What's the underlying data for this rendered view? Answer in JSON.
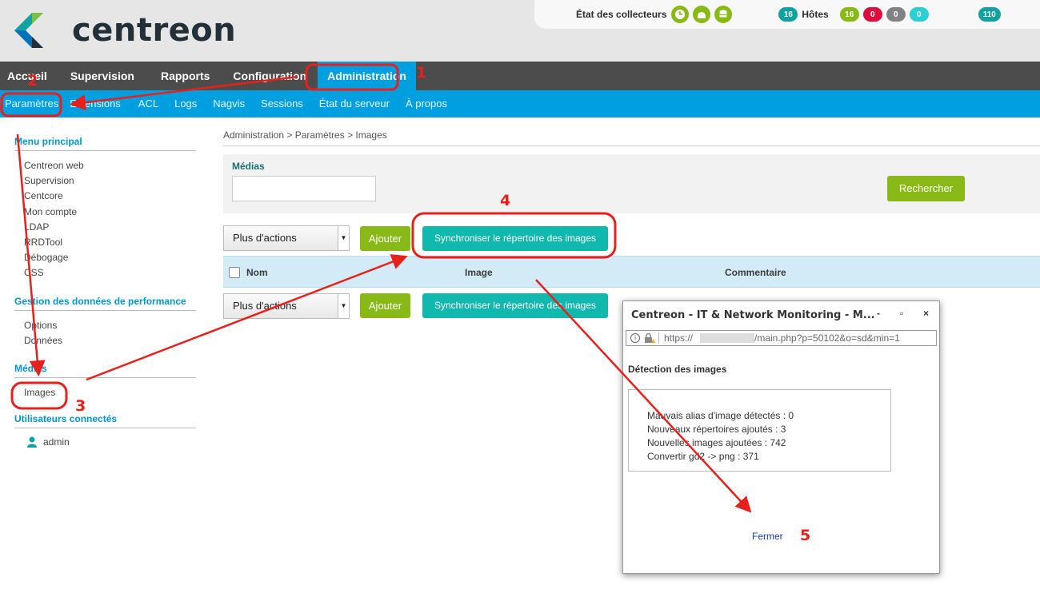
{
  "header": {
    "logo_text": "centreon",
    "collectors_label": "État des collecteurs",
    "hosts_count": "16",
    "hosts_label": "Hôtes",
    "host_status": [
      "16",
      "0",
      "0",
      "0"
    ],
    "services_count": "110"
  },
  "main_nav": [
    "Accueil",
    "Supervision",
    "Rapports",
    "Configuration",
    "Administration"
  ],
  "sub_nav": [
    "Paramètres",
    "Extensions",
    "ACL",
    "Logs",
    "Nagvis",
    "Sessions",
    "État du serveur",
    "À propos"
  ],
  "sidebar": {
    "sections": [
      {
        "title": "Menu principal",
        "items": [
          "Centreon web",
          "Supervision",
          "Centcore",
          "Mon compte",
          "LDAP",
          "RRDTool",
          "Débogage",
          "CSS"
        ]
      },
      {
        "title": "Gestion des données de performance",
        "items": [
          "Options",
          "Données"
        ]
      },
      {
        "title": "Médias",
        "items": [
          "Images"
        ]
      },
      {
        "title": "Utilisateurs connectés",
        "items": []
      }
    ],
    "user": "admin"
  },
  "breadcrumb": "Administration > Paramètres > Images",
  "filter": {
    "label": "Médias",
    "search_value": "",
    "search_button": "Rechercher"
  },
  "actions": {
    "more_actions": "Plus d'actions",
    "add": "Ajouter",
    "sync": "Synchroniser le répertoire des images"
  },
  "table": {
    "columns": [
      "Nom",
      "Image",
      "Commentaire"
    ]
  },
  "popup": {
    "title": "Centreon - IT & Network Monitoring - M...",
    "controls": [
      "-",
      "▫",
      "×"
    ],
    "url_prefix": "https://",
    "url_suffix": "/main.php?p=50102&o=sd&min=1",
    "detection_title": "Détection des images",
    "results": [
      "Mauvais alias d'image détectés : 0",
      "Nouveaux répertoires ajoutés : 3",
      "Nouvelles images ajoutées : 742",
      "Convertir gd2 -> png : 371"
    ],
    "close": "Fermer"
  },
  "annotations": [
    "1",
    "2",
    "3",
    "4",
    "5"
  ],
  "annotation_color": "#e8201c"
}
